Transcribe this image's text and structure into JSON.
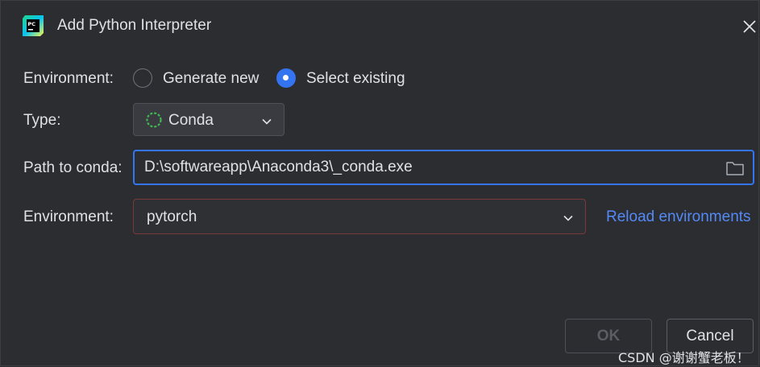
{
  "window": {
    "title": "Add Python Interpreter",
    "close_icon": "close-icon",
    "logo_icon": "pycharm-logo-icon"
  },
  "environment_mode": {
    "label": "Environment:",
    "options": [
      {
        "label": "Generate new",
        "selected": false
      },
      {
        "label": "Select existing",
        "selected": true
      }
    ]
  },
  "type": {
    "label": "Type:",
    "value": "Conda",
    "icon": "conda-icon",
    "icon_color": "#3fb950"
  },
  "path": {
    "label": "Path to conda:",
    "value": "D:\\softwareapp\\Anaconda3\\_conda.exe",
    "browse_icon": "folder-icon"
  },
  "environment": {
    "label": "Environment:",
    "value": "pytorch",
    "reload_link": "Reload environments"
  },
  "buttons": {
    "ok": "OK",
    "cancel": "Cancel"
  },
  "watermark": "CSDN @谢谢蟹老板！",
  "colors": {
    "background": "#2b2d30",
    "accent": "#3574f0",
    "link": "#548af7",
    "error_border": "#7a3a3a"
  }
}
